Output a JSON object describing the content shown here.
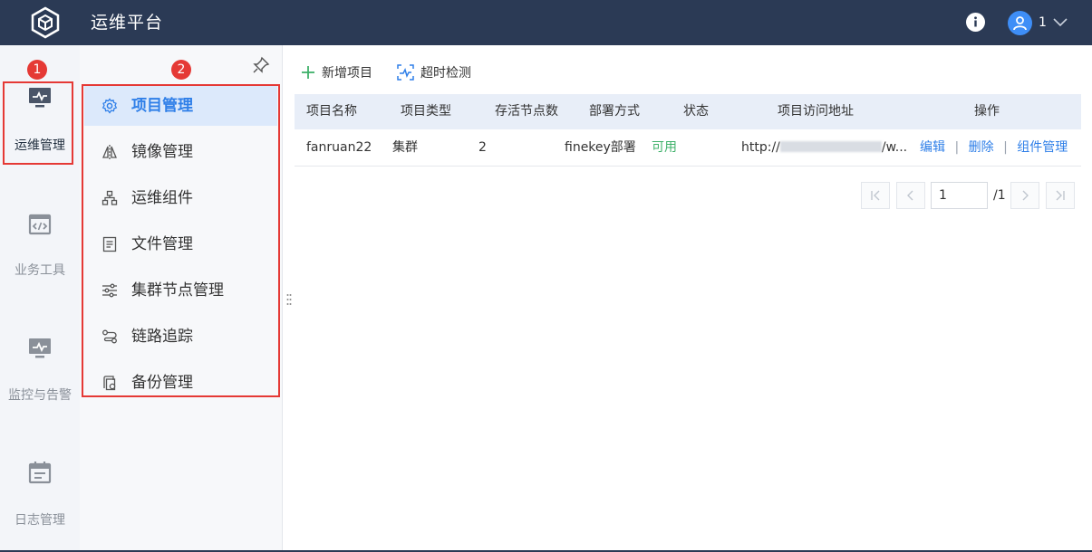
{
  "header": {
    "title": "运维平台",
    "user_name": "1"
  },
  "rail": [
    {
      "label": "运维管理",
      "icon": "monitor-wave-icon"
    },
    {
      "label": "业务工具",
      "icon": "code-window-icon"
    },
    {
      "label": "监控与告警",
      "icon": "monitor-chart-icon"
    },
    {
      "label": "日志管理",
      "icon": "calendar-doc-icon"
    }
  ],
  "annotations": {
    "badge1": "1",
    "badge2": "2"
  },
  "menu": [
    {
      "label": "项目管理",
      "icon": "gear-icon"
    },
    {
      "label": "镜像管理",
      "icon": "mirror-icon"
    },
    {
      "label": "运维组件",
      "icon": "hierarchy-icon"
    },
    {
      "label": "文件管理",
      "icon": "file-icon"
    },
    {
      "label": "集群节点管理",
      "icon": "sliders-icon"
    },
    {
      "label": "链路追踪",
      "icon": "route-icon"
    },
    {
      "label": "备份管理",
      "icon": "backup-icon"
    }
  ],
  "toolbar": {
    "add_label": "新增项目",
    "timeout_label": "超时检测"
  },
  "table": {
    "columns": [
      "项目名称",
      "项目类型",
      "存活节点数",
      "部署方式",
      "状态",
      "项目访问地址",
      "操作"
    ],
    "rows": [
      {
        "name": "fanruan22",
        "type": "集群",
        "alive": "2",
        "deploy": "finekey部署",
        "status": "可用",
        "url_prefix": "http://",
        "url_suffix": "/w...",
        "actions": [
          "编辑",
          "删除",
          "组件管理"
        ]
      }
    ]
  },
  "pagination": {
    "current": "1",
    "total": "/1"
  },
  "colors": {
    "topbar": "#2b3a55",
    "accent": "#2f7fe8",
    "highlight": "#e53935",
    "ok": "#3fb16a"
  }
}
